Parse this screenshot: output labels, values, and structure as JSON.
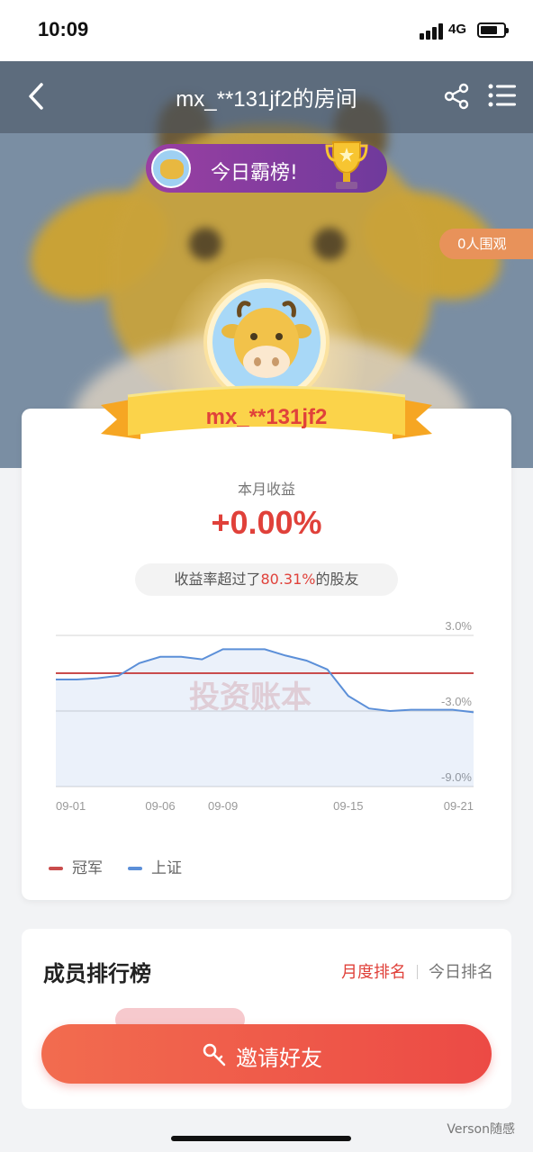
{
  "status_bar": {
    "time": "10:09",
    "network": "4G"
  },
  "header": {
    "title": "mx_**131jf2的房间"
  },
  "hero": {
    "daily_badge": "今日霸榜!",
    "watchers": "0人围观",
    "username": "mx_**131jf2"
  },
  "summary": {
    "month_label": "本月收益",
    "month_value": "+0.00%",
    "beat_prefix": "收益率超过了",
    "beat_pct": "80.31%",
    "beat_suffix": "的股友"
  },
  "chart_data": {
    "type": "line",
    "x": [
      "09-01",
      "09-02",
      "09-03",
      "09-04",
      "09-05",
      "09-06",
      "09-07",
      "09-08",
      "09-09",
      "09-10",
      "09-11",
      "09-12",
      "09-13",
      "09-14",
      "09-15",
      "09-16",
      "09-17",
      "09-18",
      "09-19",
      "09-20",
      "09-21"
    ],
    "x_tick_labels": [
      "09-01",
      "09-06",
      "09-09",
      "09-15",
      "09-21"
    ],
    "y_tick_labels": [
      "3.0%",
      "-3.0%",
      "-9.0%"
    ],
    "ylim": [
      -9.0,
      3.0
    ],
    "series": [
      {
        "name": "冠军",
        "color": "#c94c4c",
        "values": [
          0,
          0,
          0,
          0,
          0,
          0,
          0,
          0,
          0,
          0,
          0,
          0,
          0,
          0,
          0,
          0,
          0,
          0,
          0,
          0,
          0
        ]
      },
      {
        "name": "上证",
        "color": "#5b8fd8",
        "values": [
          -0.5,
          -0.5,
          -0.4,
          -0.2,
          0.8,
          1.3,
          1.3,
          1.1,
          1.9,
          1.9,
          1.9,
          1.4,
          1.0,
          0.3,
          -1.8,
          -2.8,
          -3.0,
          -2.9,
          -2.9,
          -2.9,
          -3.1
        ]
      }
    ],
    "watermark": "投资账本",
    "grid": true,
    "legend": "bottom-left"
  },
  "ranking": {
    "title": "成员排行榜",
    "tab_month": "月度排名",
    "tab_today": "今日排名"
  },
  "invite": {
    "label": "邀请好友"
  },
  "footer": {
    "watermark": "Verson随感"
  }
}
